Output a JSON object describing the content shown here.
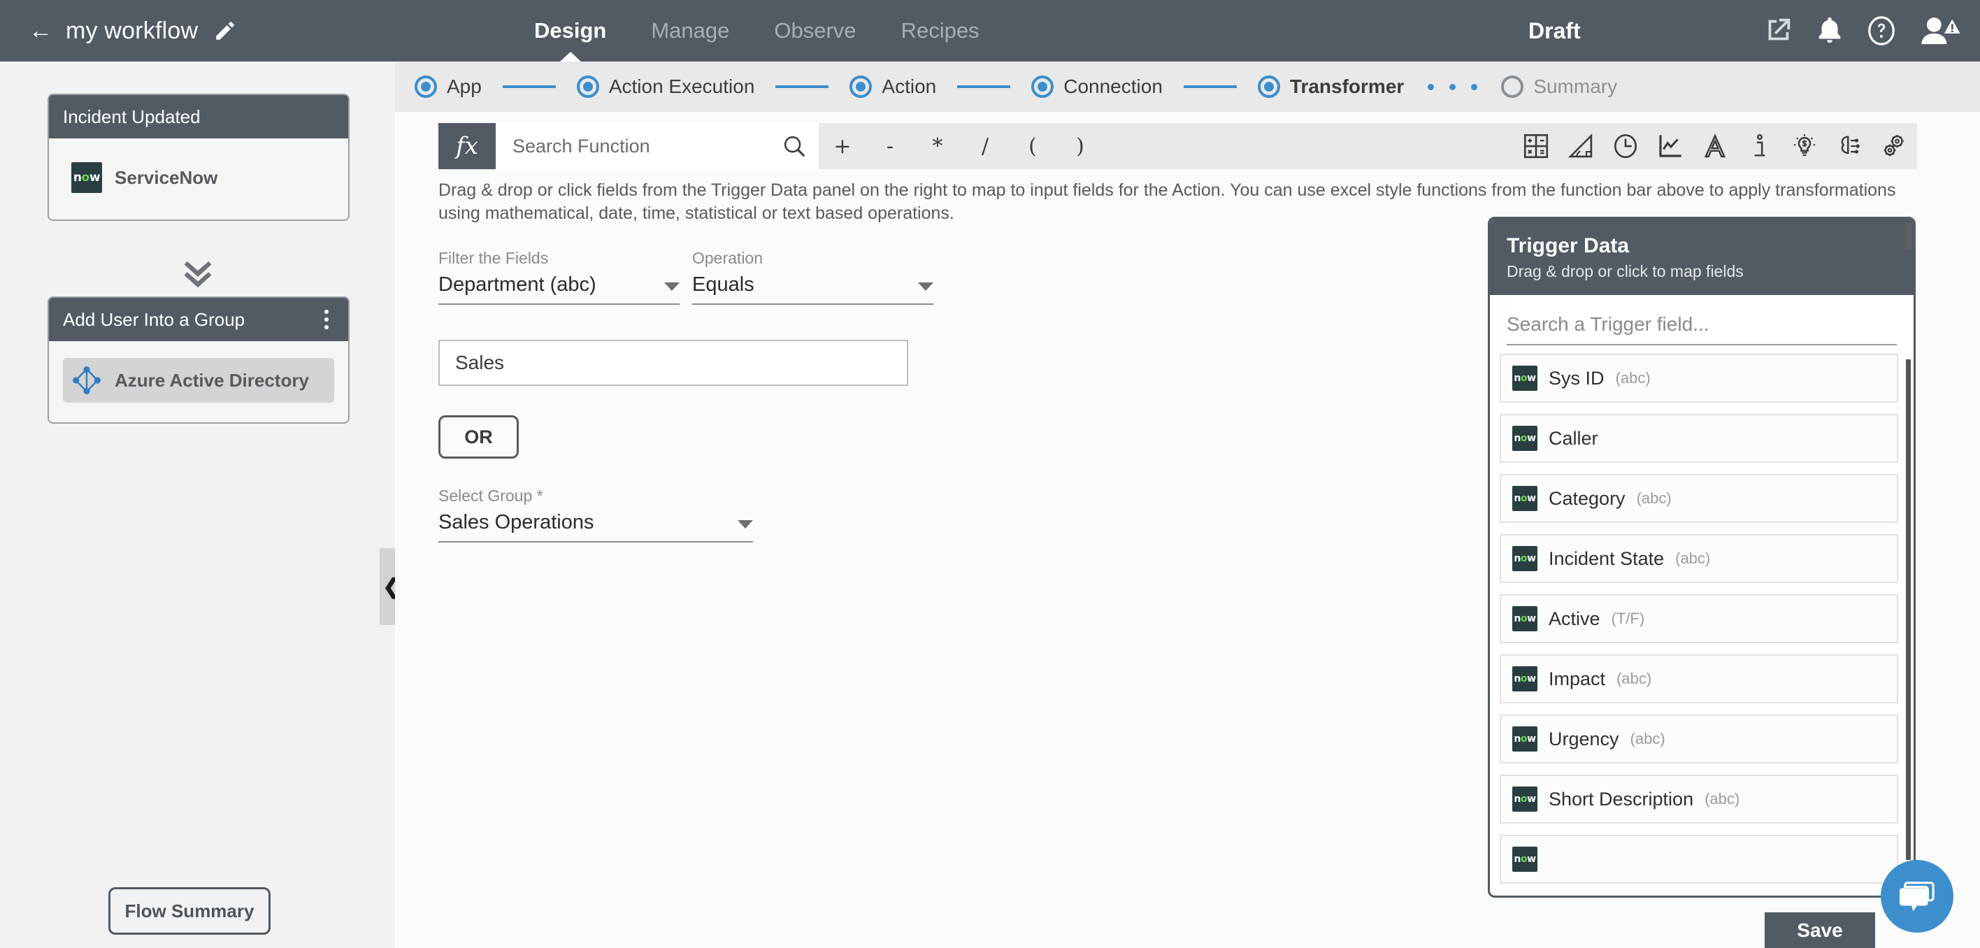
{
  "topbar": {
    "back_icon": "back-arrow-icon",
    "workflow_name": "my workflow",
    "edit_icon": "pencil-icon",
    "tabs": [
      {
        "label": "Design",
        "active": true
      },
      {
        "label": "Manage",
        "active": false
      },
      {
        "label": "Observe",
        "active": false
      },
      {
        "label": "Recipes",
        "active": false
      }
    ],
    "status": "Draft",
    "icons": [
      "external-link-icon",
      "bell-icon",
      "help-icon",
      "avatar-icon",
      "warning-icon"
    ]
  },
  "stepper": {
    "steps": [
      {
        "label": "App",
        "state": "complete"
      },
      {
        "label": "Action Execution",
        "state": "complete"
      },
      {
        "label": "Action",
        "state": "complete"
      },
      {
        "label": "Connection",
        "state": "complete"
      },
      {
        "label": "Transformer",
        "state": "current"
      },
      {
        "label": "Summary",
        "state": "pending"
      }
    ],
    "accent_color": "#3d8ecc",
    "pending_color": "#8b9096"
  },
  "left_panel": {
    "cards": [
      {
        "title": "Incident Updated",
        "app": "ServiceNow",
        "app_icon": "servicenow-now-icon",
        "selected": false,
        "has_menu": false
      },
      {
        "title": "Add User Into a Group",
        "app": "Azure Active Directory",
        "app_icon": "azure-active-directory-icon",
        "selected": true,
        "has_menu": true
      }
    ],
    "connector_icon": "double-chevron-down-icon",
    "flow_summary_label": "Flow Summary",
    "collapse_icon": "chevron-left-icon"
  },
  "function_bar": {
    "fx_label": "fx",
    "search_placeholder": "Search Function",
    "search_icon": "search-icon",
    "operators": [
      "+",
      "-",
      "*",
      "/",
      "(",
      ")"
    ],
    "category_icons": [
      "calculator-icon",
      "trigonometry-icon",
      "clock-icon",
      "chart-icon",
      "text-icon",
      "info-icon",
      "financial-icon",
      "ai-brain-icon",
      "utility-gears-icon"
    ]
  },
  "instructions": "Drag & drop or click fields from the Trigger Data panel on the right to map to input fields for the Action. You can use excel style functions from the function bar above to apply transformations using mathematical, date, time, statistical or text based operations.",
  "form": {
    "filter_label": "Filter the Fields",
    "filter_value": "Department (abc)",
    "operation_label": "Operation",
    "operation_value": "Equals",
    "value_input": "Sales",
    "or_label": "OR",
    "group_label": "Select Group *",
    "group_value": "Sales Operations",
    "add_icon": "plus-circle-icon"
  },
  "trigger_panel": {
    "title": "Trigger Data",
    "subtitle": "Drag & drop or click to map fields",
    "search_placeholder": "Search a Trigger field...",
    "fields": [
      {
        "name": "Sys ID",
        "type": "(abc)",
        "icon": "servicenow-now-icon"
      },
      {
        "name": "Caller",
        "type": "",
        "icon": "servicenow-now-icon"
      },
      {
        "name": "Category",
        "type": "(abc)",
        "icon": "servicenow-now-icon"
      },
      {
        "name": "Incident State",
        "type": "(abc)",
        "icon": "servicenow-now-icon"
      },
      {
        "name": "Active",
        "type": "(T/F)",
        "icon": "servicenow-now-icon"
      },
      {
        "name": "Impact",
        "type": "(abc)",
        "icon": "servicenow-now-icon"
      },
      {
        "name": "Urgency",
        "type": "(abc)",
        "icon": "servicenow-now-icon"
      },
      {
        "name": "Short Description",
        "type": "(abc)",
        "icon": "servicenow-now-icon"
      }
    ]
  },
  "footer": {
    "save_label": "Save",
    "chat_icon": "chat-bubble-icon"
  }
}
